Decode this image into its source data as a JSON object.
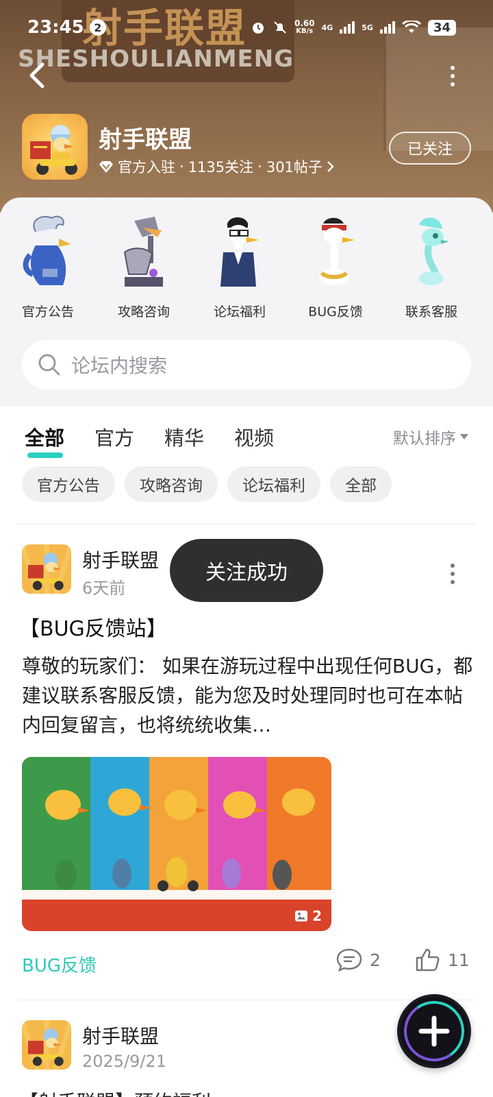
{
  "status_bar": {
    "time": "23:45",
    "notification_count": "2",
    "net_speed_value": "0.60",
    "net_speed_unit": "KB/s",
    "sig1": "4G",
    "sig2": "5G",
    "battery": "34"
  },
  "banner": {
    "sign_text": "射手联盟",
    "sign_sub": "SHESHOULIANMENG"
  },
  "forum": {
    "name": "射手联盟",
    "official": "官方入驻",
    "followers": "1135关注",
    "posts": "301帖子",
    "sep": "·",
    "follow_state": "已关注"
  },
  "categories": [
    {
      "label": "官方公告",
      "icon": "eagle-character-icon"
    },
    {
      "label": "攻略咨询",
      "icon": "robot-character-icon"
    },
    {
      "label": "论坛福利",
      "icon": "goose-glasses-icon"
    },
    {
      "label": "BUG反馈",
      "icon": "goose-bandana-icon"
    },
    {
      "label": "联系客服",
      "icon": "ghost-character-icon"
    }
  ],
  "search": {
    "placeholder": "论坛内搜索"
  },
  "tabs": [
    "全部",
    "官方",
    "精华",
    "视频"
  ],
  "sort_label": "默认排序",
  "chips": [
    "官方公告",
    "攻略咨询",
    "论坛福利",
    "全部"
  ],
  "toast": "关注成功",
  "post": {
    "author": "射手联盟",
    "time": "6天前",
    "title": "【BUG反馈站】",
    "body": "尊敬的玩家们：  如果在游玩过程中出现任何BUG，都建议联系客服反馈，能为您及时处理同时也可在本帖内回复留言，也将统统收集…",
    "image_count": "2",
    "tag": "BUG反馈",
    "comments": "2",
    "likes": "11"
  },
  "post2": {
    "author": "射手联盟",
    "time": "2025/9/21",
    "title_partial": "【射手联盟】预约福利"
  },
  "colors": {
    "accent": "#2ad1c0",
    "toast_bg": "#2f2f2f"
  }
}
